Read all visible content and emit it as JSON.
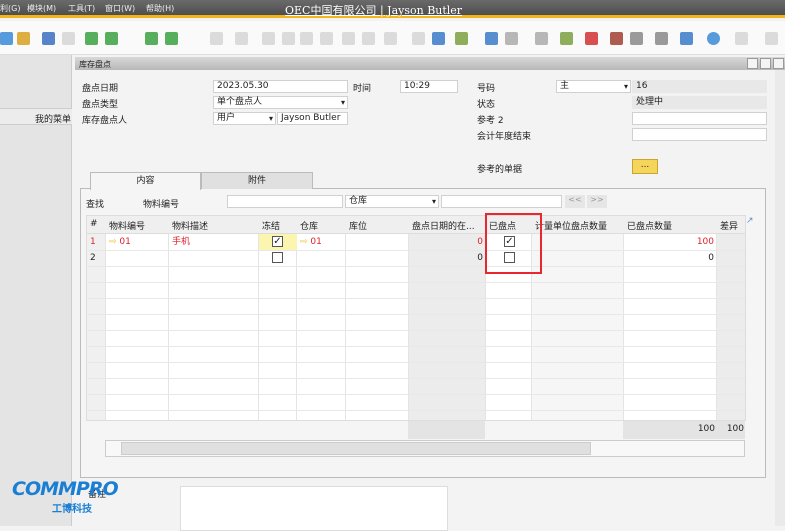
{
  "menu": [
    "利(G)",
    "模块(M)",
    "工具(T)",
    "窗口(W)",
    "帮助(H)"
  ],
  "app_title": "OEC中国有限公司 | Jayson Butler",
  "left_panel": {
    "my_menu": "我的菜单"
  },
  "window": {
    "title": "库存盘点"
  },
  "form": {
    "count_date_label": "盘点日期",
    "count_date": "2023.05.30",
    "time_label": "时间",
    "time": "10:29",
    "count_type_label": "盘点类型",
    "count_type": "单个盘点人",
    "counter_label": "库存盘点人",
    "counter_type": "用户",
    "counter_name": "Jayson Butler",
    "number_label": "号码",
    "series": "主",
    "number": "16",
    "status_label": "状态",
    "status": "处理中",
    "ref2_label": "参考 2",
    "ref2": "",
    "fy_end_label": "会计年度结束",
    "fy_end": "",
    "ref_docs_label": "参考的单据",
    "ref_docs_button": "..."
  },
  "tabs": [
    "内容",
    "附件"
  ],
  "find": {
    "label": "查找",
    "field_label": "物料编号",
    "value": "",
    "warehouse_select": "仓库",
    "warehouse_value": "",
    "prev": "<<",
    "next": ">>"
  },
  "table": {
    "headers": [
      "#",
      "物料编号",
      "物料描述",
      "冻结",
      "仓库",
      "库位",
      "盘点日期的在...",
      "已盘点",
      "计量单位盘点数量",
      "已盘点数量",
      "差异"
    ],
    "rows": [
      {
        "num": "1",
        "item": "01",
        "desc": "手机",
        "frozen": true,
        "whs": "01",
        "bin": "",
        "instock": "0",
        "counted": true,
        "uom_qty": "",
        "counted_qty": "100",
        "diff": ""
      },
      {
        "num": "2",
        "item": "",
        "desc": "",
        "frozen": false,
        "whs": "",
        "bin": "",
        "instock": "0",
        "counted": false,
        "uom_qty": "",
        "counted_qty": "0",
        "diff": ""
      }
    ],
    "totals": {
      "counted_qty": "100",
      "diff": "100"
    }
  },
  "remarks_label": "备注",
  "logo": {
    "text": "COMMPRO",
    "sub": "工博科技"
  },
  "colors": {
    "accent": "#f2b418",
    "highlight_box": "#e8282e",
    "row_text": "#e0202a"
  }
}
